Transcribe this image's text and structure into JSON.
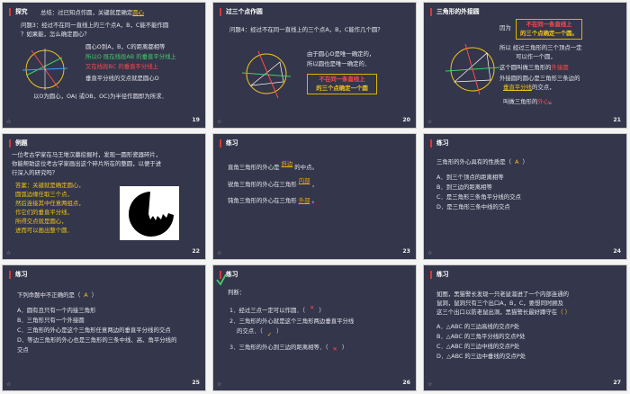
{
  "slides": [
    {
      "n": "19",
      "title": "探究",
      "lines": {
        "summary": "总结：过已知点作圆，关键就是确定",
        "summary_hl": "圆心",
        "q3a": "问题3：经过不在同一直线上的三个点A，B，C能不能作圆",
        "q3b": "？如果能，怎么确定圆心？",
        "l1": "圆心O到A，B，C的距离都相等",
        "l2": "所以O 既在线段AB 的垂直平分线上",
        "l3": "又在线段BC 的垂直平分线上",
        "l4": "垂直平分线的交点就是圆心O",
        "l5": "以O为圆心，OA( 或OB，OC)为半径作圆即为所求．"
      }
    },
    {
      "n": "20",
      "title": "过三个点作圆",
      "lines": {
        "q4": "问题4：经过不在同一直线上的三个点A，B，C能作几个圆？",
        "a1": "由于圆心O是唯一确定的，",
        "a2": "所以圆也是唯一确定的．",
        "b1": "不在同一条直线上",
        "b2": "的三个点确定一个圆"
      }
    },
    {
      "n": "21",
      "title": "三角形的外接圆",
      "lines": {
        "yin": "因为",
        "b1": "不在同一条直线上",
        "b2": "的三个点确定一个圆。",
        "s1": "所以  经过三角形的三个顶点一定",
        "s2": "可以作一个圆，",
        "s3": "这个圆叫做三角形的",
        "s3h": "外接圆",
        "s4": "外接圆的圆心是三角形三条边的",
        "s5": "垂直平分线",
        "s5b": "的交点，",
        "s6": "叫做三角形的",
        "s6h": "外心",
        "s6e": "。"
      }
    },
    {
      "n": "22",
      "title": "例题",
      "lines": {
        "p1": "一位考古学家在马王堆汉墓挖掘时，发现一圆形瓷器碎片，",
        "p2": "你能帮助这位考古学家画出这个碎片所在的整圆，以便于进",
        "p3": "行深入的研究吗？",
        "a1": "答案：关键就是确定圆心，",
        "a2": "圆弧边缘任取三个点，",
        "a3": "然后连接其中任意两组点，",
        "a4": "作它们的垂直平分线，",
        "a5": "所得交点就是圆心，",
        "a6": "进而可以画出整个圆．"
      }
    },
    {
      "n": "23",
      "title": "练习",
      "lines": {
        "l1a": "直角三角形的外心是",
        "l1b": "斜边",
        "l1c": "的中点。",
        "l2a": "锐角三角形的外心在三角形",
        "l2b": "内部",
        "l2c": "，",
        "l3a": "钝角三角形的外心在三角形",
        "l3b": "外部",
        "l3c": "。"
      }
    },
    {
      "n": "24",
      "title": "练习",
      "lines": {
        "q": "三角形的外心具有的性质是（",
        "ans": "A",
        "qe": "）",
        "a": "A．到三个顶点的距离相等",
        "b": "B．到三边的距离相等",
        "c": "C．是三角形三条角平分线的交点",
        "d": "D．是三角形三条中线的交点"
      }
    },
    {
      "n": "25",
      "title": "练习",
      "lines": {
        "q": "下列命题中不正确的是（",
        "ans": "A",
        "qe": "）",
        "a": "A．圆有且只有一个内接三角形",
        "b": "B．三角形只有一个外接圆",
        "c": "C．三角形的外心是这个三角形任意两边的垂直平分线的交点",
        "d": "D．等边三角形的外心也是三角形的三条中线、高、角平分线的",
        "d2": "交点"
      }
    },
    {
      "n": "26",
      "title": "练习",
      "lines": {
        "h": "判断：",
        "j1": "1．经过三点一定可以作圆．（",
        "j1m": "✕",
        "j1e": "）",
        "j2": "2．三角形的外心就是这个三角形两边垂直平分线",
        "j2b": "的交点．（",
        "j2m": "✓",
        "j2e": "）",
        "j3": "3．三角形的外心到三边的距离相等．（",
        "j3m": "✕",
        "j3e": "）"
      }
    },
    {
      "n": "27",
      "title": "练习",
      "lines": {
        "p1": "如图，黑猫警长发现一只老鼠溜进了一个内部连通的",
        "p2": "鼠洞，鼠洞只有三个出口A，B，C，要想同时顾及",
        "p3": "这三个出口以防老鼠出洞，黑猫警长最好蹲守在",
        "p3h": "（   ）",
        "p4": "A．△ABC 的三边高线的交点P处",
        "p5": "B．△ABC 的三角平分线的交点P处",
        "p6": "C．△ABC 的三边中线的交点P处",
        "p7": "D．△ABC 的三边中垂线的交点P处"
      }
    }
  ],
  "star": "☆"
}
